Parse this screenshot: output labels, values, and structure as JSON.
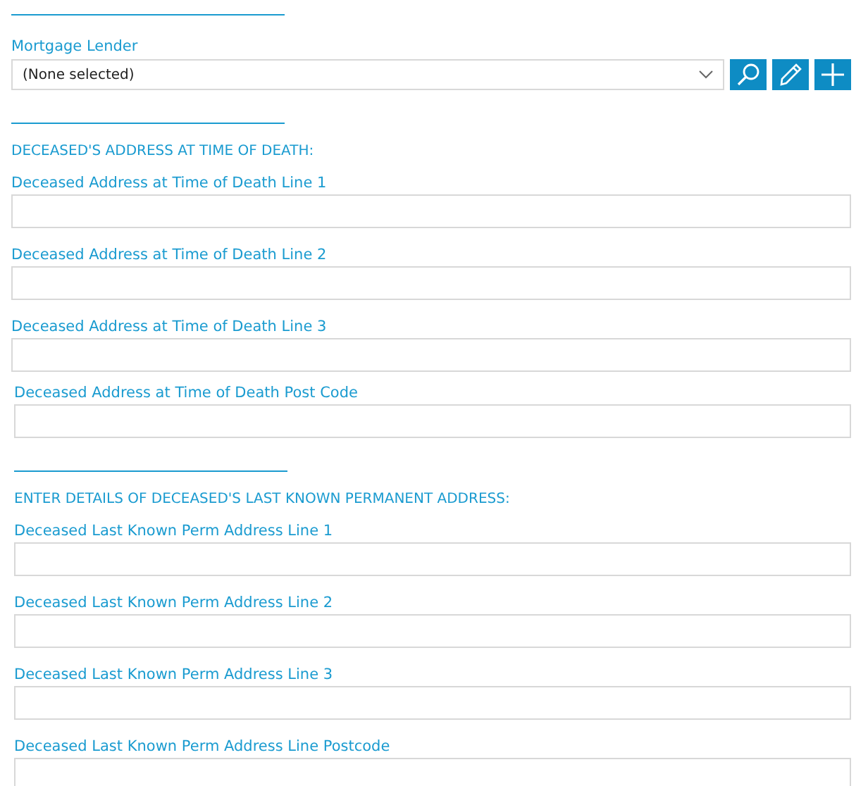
{
  "mortgage_lender": {
    "label": "Mortgage Lender",
    "value": "(None selected)",
    "buttons": [
      {
        "kind": "search"
      },
      {
        "kind": "edit"
      },
      {
        "kind": "add"
      }
    ]
  },
  "sections": [
    {
      "heading": "DECEASED'S ADDRESS AT TIME OF DEATH:",
      "fields": [
        {
          "label": "Deceased Address at Time of Death Line 1"
        },
        {
          "label": "Deceased Address at Time of Death Line 2"
        },
        {
          "label": "Deceased Address at Time of Death Line 3"
        },
        {
          "label": "Deceased Address at Time of Death Post Code"
        }
      ]
    },
    {
      "heading": "ENTER DETAILS OF DECEASED'S LAST KNOWN PERMANENT ADDRESS:",
      "fields": [
        {
          "label": "Deceased Last Known Perm Address Line 1"
        },
        {
          "label": "Deceased Last Known Perm Address Line 2"
        },
        {
          "label": "Deceased Last Known Perm Address Line 3"
        },
        {
          "label": "Deceased Last Known Perm Address Line Postcode"
        }
      ]
    }
  ]
}
